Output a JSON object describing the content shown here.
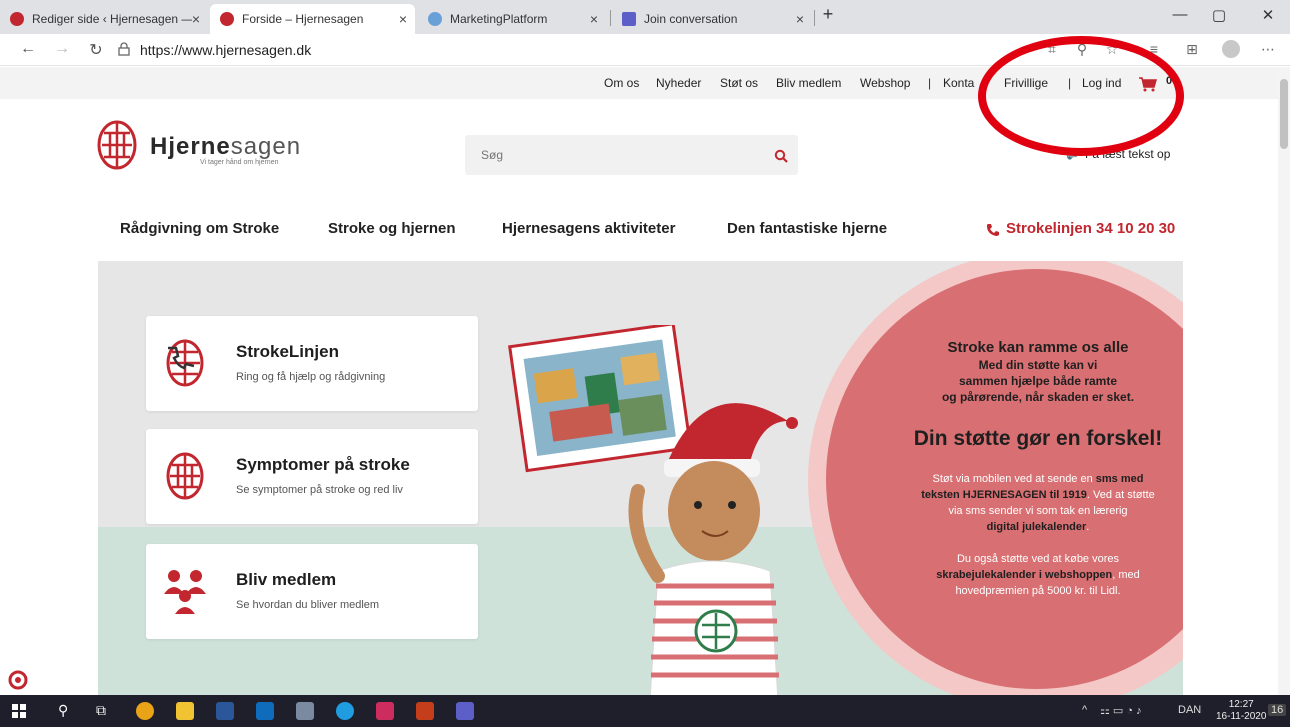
{
  "browser": {
    "tabs": [
      {
        "title": "Rediger side ‹ Hjernesagen — W",
        "favicon_color": "#c2262e"
      },
      {
        "title": "Forside – Hjernesagen",
        "favicon_color": "#c2262e"
      },
      {
        "title": "MarketingPlatform",
        "favicon_color": "#6aa0d8"
      },
      {
        "title": "Join conversation",
        "favicon_color": "#5b5fc7"
      }
    ],
    "new_tab": "+",
    "close_glyph": "×",
    "url": "https://www.hjernesagen.dk",
    "window_controls": [
      "—",
      "▢",
      "✕"
    ]
  },
  "site": {
    "top_nav": [
      "Om os",
      "Nyheder",
      "Støt os",
      "Bliv medlem",
      "Webshop",
      "Konta",
      "Frivillige",
      "Log ind"
    ],
    "top_sep": "|",
    "cart_count": "0",
    "logo": {
      "prefix": "Hjerne",
      "suffix": "sagen",
      "tagline": "Vi tager hånd om hjernen"
    },
    "search_placeholder": "Søg",
    "read_aloud": "Få læst tekst op",
    "main_nav": [
      "Rådgivning om Stroke",
      "Stroke og hjernen",
      "Hjernesagens aktiviteter",
      "Den fantastiske hjerne"
    ],
    "hotline": "Strokelinjen 34 10 20 30",
    "cards": [
      {
        "title": "StrokeLinjen",
        "subtitle": "Ring og få hjælp og rådgivning"
      },
      {
        "title": "Symptomer på stroke",
        "subtitle": "Se symptomer på stroke og red liv"
      },
      {
        "title": "Bliv medlem",
        "subtitle": "Se hvordan du bliver medlem"
      }
    ],
    "promo": {
      "head1": "Stroke kan ramme os alle",
      "head2a": "Med din støtte kan vi",
      "head2b": "sammen hjælpe både ramte",
      "head2c": "og pårørende, når skaden er sket.",
      "big": "Din støtte gør en forskel!",
      "p1a": "Støt via mobilen ved at sende en ",
      "p1b": "sms med",
      "p1c": "teksten HJERNESAGEN til 1919",
      "p1d": ". Ved at støtte",
      "p1e": "via sms sender vi som tak en lærerig",
      "p1f": "digital julekalender",
      "p1g": ".",
      "p2a": "Du også støtte ved at købe vores",
      "p2b": "skrabejulekalender i webshoppen",
      "p2c": ", med",
      "p2d": "hovedpræmien på 5000 kr. til Lidl."
    }
  },
  "taskbar": {
    "lang": "DAN",
    "time": "12:27",
    "date": "16-11-2020",
    "notif": "16",
    "tray_caret": "^"
  },
  "colors": {
    "brand_red": "#c2262e",
    "hero_bg": "#e6e6e6",
    "circle": "#d86f72",
    "annotation": "#e1000f"
  }
}
